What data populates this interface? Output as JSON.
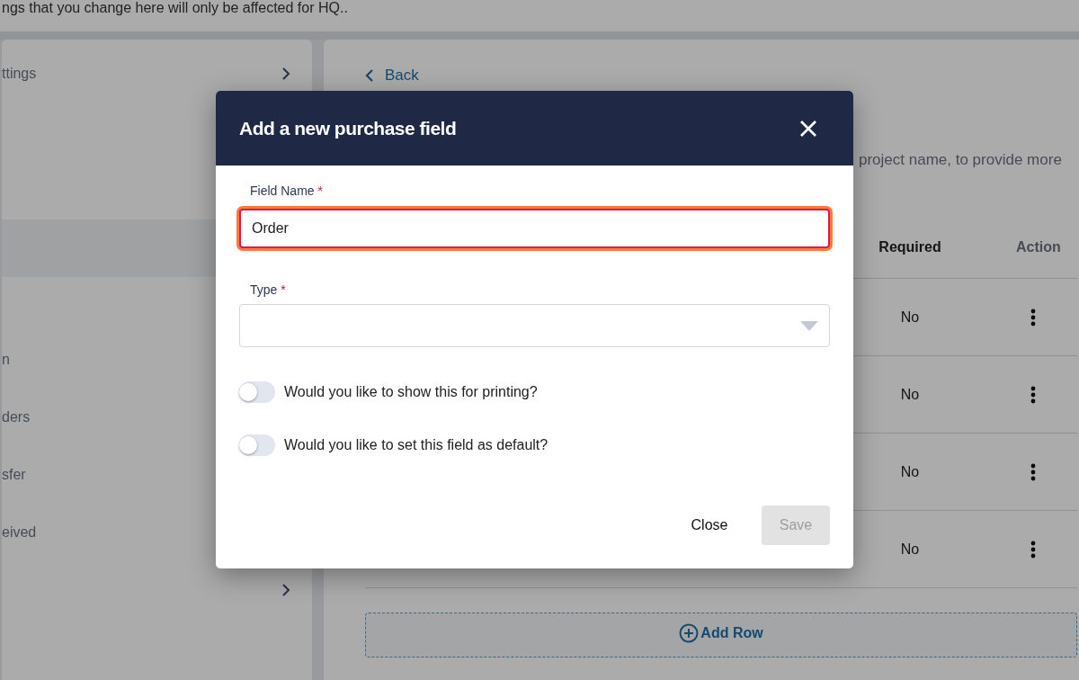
{
  "notice": "ngs that you change here will only be affected for HQ..",
  "sidebar": {
    "items": [
      {
        "kind": "header",
        "label": "ttings",
        "selected": false
      },
      {
        "kind": "item",
        "selected": true
      },
      {
        "kind": "item",
        "label": "n",
        "selected": false
      },
      {
        "kind": "item",
        "label": "ders",
        "selected": false
      },
      {
        "kind": "item",
        "label": "sfer",
        "selected": false
      },
      {
        "kind": "item",
        "label": "eived",
        "selected": false
      },
      {
        "kind": "footer"
      }
    ]
  },
  "main": {
    "back": "Back",
    "description": "project name, to provide more",
    "table": {
      "columns": [
        "Required",
        "Action"
      ],
      "rows": [
        {
          "required": "No"
        },
        {
          "required": "No"
        },
        {
          "required": "No"
        },
        {
          "required": "No"
        }
      ],
      "add_row": "Add Row"
    }
  },
  "dialog": {
    "title": "Add a new purchase field",
    "fields": [
      {
        "kind": "text",
        "label": "Field Name",
        "required_mark": "*",
        "value": "Order",
        "focused": true
      },
      {
        "kind": "select",
        "label": "Type",
        "required_mark": "*",
        "focused": false
      }
    ],
    "toggles": [
      {
        "label": "Would you like to show this for printing?",
        "on": false
      },
      {
        "label": "Would you like to set this field as default?",
        "on": false
      }
    ],
    "buttons": [
      {
        "kind": "text",
        "label": "Close",
        "disabled": false
      },
      {
        "kind": "filled",
        "label": "Save",
        "disabled": true
      }
    ]
  }
}
